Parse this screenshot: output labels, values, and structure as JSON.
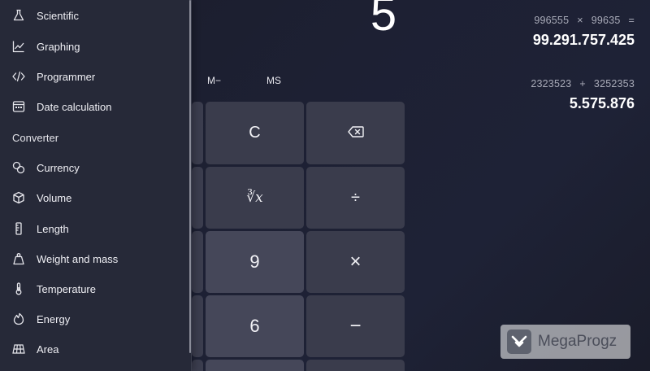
{
  "display": {
    "value": "5"
  },
  "memory": {
    "m_minus": "M−",
    "ms": "MS"
  },
  "keypad": {
    "clear": "C",
    "backspace_icon": "backspace-icon",
    "cube_root": "∛x",
    "divide": "÷",
    "nine": "9",
    "multiply": "×",
    "six": "6",
    "minus": "−"
  },
  "history": [
    {
      "operand_a": "996555",
      "operator": "×",
      "operand_b": "99635",
      "equals": "=",
      "result": "99.291.757.425"
    },
    {
      "operand_a": "2323523",
      "operator": "+",
      "operand_b": "3252353",
      "equals": "",
      "result": "5.575.876"
    }
  ],
  "nav": {
    "calculators": [
      {
        "label": "Scientific",
        "icon": "flask-icon"
      },
      {
        "label": "Graphing",
        "icon": "graph-icon"
      },
      {
        "label": "Programmer",
        "icon": "code-icon"
      },
      {
        "label": "Date calculation",
        "icon": "calendar-icon"
      }
    ],
    "converter_heading": "Converter",
    "converters": [
      {
        "label": "Currency",
        "icon": "currency-icon"
      },
      {
        "label": "Volume",
        "icon": "cube-icon"
      },
      {
        "label": "Length",
        "icon": "ruler-icon"
      },
      {
        "label": "Weight and mass",
        "icon": "weight-icon"
      },
      {
        "label": "Temperature",
        "icon": "thermometer-icon"
      },
      {
        "label": "Energy",
        "icon": "flame-icon"
      },
      {
        "label": "Area",
        "icon": "area-grid-icon"
      }
    ]
  },
  "watermark": {
    "text": "MegaProgz"
  },
  "colors": {
    "background": "#1d2033",
    "nav_panel": "#262938",
    "key_number": "#454759",
    "key_function": "#3a3c4c"
  }
}
